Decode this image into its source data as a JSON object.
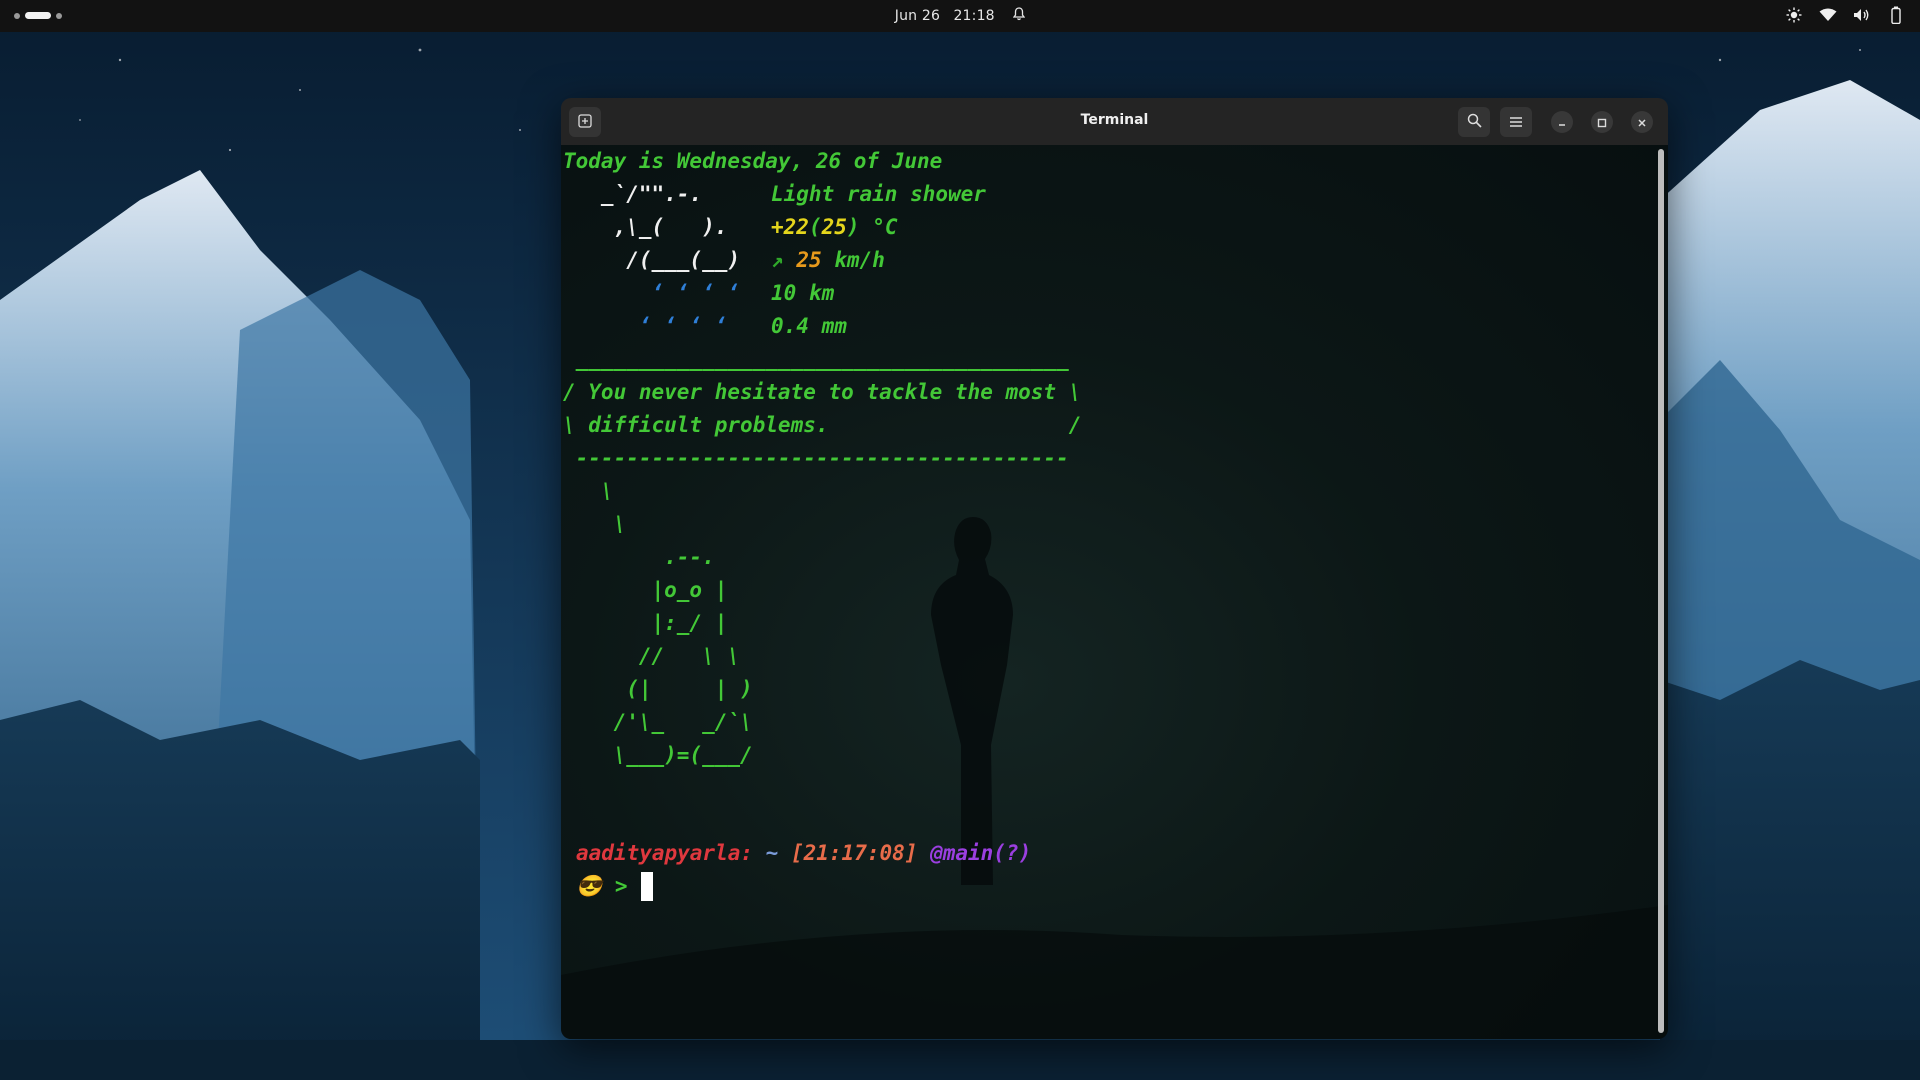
{
  "topbar": {
    "date": "Jun 26",
    "time": "21:18",
    "icons": [
      "workspace-indicator",
      "bell-icon",
      "brightness-icon",
      "wifi-icon",
      "volume-icon",
      "battery-icon"
    ]
  },
  "window": {
    "title": "Terminal",
    "buttons": [
      "new-tab-icon",
      "search-icon",
      "menu-icon",
      "minimize-icon",
      "maximize-icon",
      "close-icon"
    ]
  },
  "terminal": {
    "weather": {
      "heading": "Today is Wednesday, 26 of June",
      "art": [
        "   _`/\"\".-.    ",
        "    ,\\_(   ).  ",
        "     /(___(__) ",
        "       ‘ ‘ ‘ ‘ ",
        "      ‘ ‘ ‘ ‘  "
      ],
      "condition": "Light rain shower",
      "temp_main": "+22",
      "temp_feels": "25",
      "temp_unit": "°C",
      "wind_arrow": "↗",
      "wind_speed": "25",
      "wind_unit": "km/h",
      "visibility": "10 km",
      "precip": "0.4 mm"
    },
    "cowsay": {
      "top": " _______________________________________",
      "line1": "/ You never hesitate to tackle the most \\",
      "line2": "\\ difficult problems.                   /",
      "bottom": " ---------------------------------------",
      "art": [
        "   \\",
        "    \\",
        "        .--.",
        "       |o_o |",
        "       |:_/ |",
        "      //   \\ \\",
        "     (|     | )",
        "    /'\\_   _/`\\",
        "    \\___)=(___/"
      ]
    },
    "prompt": {
      "user": "aadityapyarla:",
      "path": "~",
      "time": "[21:17:08]",
      "branch": "@main(?)",
      "emoji": "😎",
      "symbol": ">"
    }
  },
  "colors": {
    "term_green": "#43c837",
    "term_yellow": "#e4d51c",
    "prompt_user": "#e0383e",
    "prompt_branch": "#9b3fe0"
  }
}
